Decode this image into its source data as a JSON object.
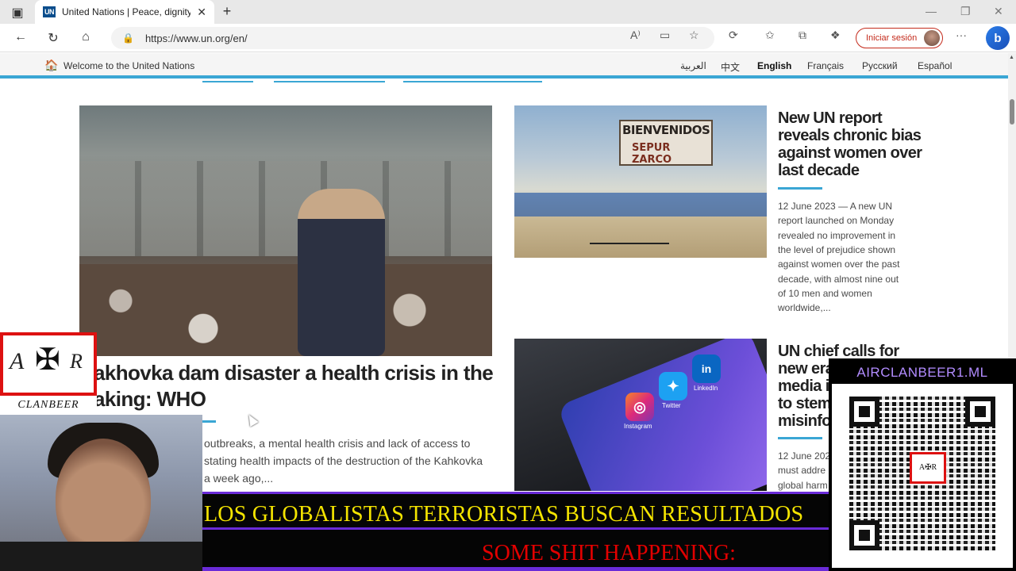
{
  "browser": {
    "tab_title": "United Nations | Peace, dignity a",
    "tab_favicon_text": "UN",
    "url": "https://www.un.org/en/",
    "signin_label": "Iniciar sesión",
    "bing_label": "b"
  },
  "unbar": {
    "welcome": "Welcome to the United Nations",
    "languages": [
      {
        "label": "العربية",
        "active": false
      },
      {
        "label": "中文",
        "active": false
      },
      {
        "label": "English",
        "active": true
      },
      {
        "label": "Français",
        "active": false
      },
      {
        "label": "Русский",
        "active": false
      },
      {
        "label": "Español",
        "active": false
      }
    ]
  },
  "main_story": {
    "headline_line1": "akhovka dam disaster a health crisis in the",
    "headline_line2": "aking: WHO",
    "summary_line1": "outbreaks, a mental health crisis and lack of access to",
    "summary_line2": "stating health impacts of the destruction of the Kahkovka",
    "summary_line3": "a week ago,..."
  },
  "story_2": {
    "image_sign_line1": "BIENVENIDOS",
    "image_sign_line2": "SEPUR ZARCO",
    "headline_lines": [
      "New UN report",
      "reveals chronic bias",
      "against women over",
      "last decade"
    ],
    "summary_lines": [
      "12 June 2023 — A new UN",
      "report launched on Monday",
      "revealed no improvement in",
      "the level of prejudice shown",
      "against women over the past",
      "decade, with almost nine out",
      "of 10 men and women",
      "worldwide,..."
    ]
  },
  "story_3": {
    "headline_lines": [
      "UN chief calls for",
      "new era",
      "media in",
      "to stem",
      "misinfor"
    ],
    "summary_lines": [
      "12 June 202",
      "must addre",
      "global harm"
    ],
    "app_labels": [
      "Instagram",
      "Twitter",
      "LinkedIn"
    ]
  },
  "overlay": {
    "logo_letters": [
      "A",
      "R"
    ],
    "logo_cross": "✠",
    "clan_label": "CLANBEER",
    "ticker_line1": "LOS GLOBALISTAS TERRORISTAS BUSCAN RESULTADOS",
    "ticker_line2": "SOME SHIT HAPPENING:",
    "qr_header": "AIRCLANBEER1.ML",
    "qr_logo_text": "A✠R"
  },
  "colors": {
    "un_blue": "#3aa6d4",
    "signin_red": "#c42b1c",
    "ticker_yellow": "#f4e400",
    "ticker_red": "#e30000",
    "ticker_purple": "#6a2bd8"
  },
  "icons": [
    "sidebar-toggle-icon",
    "close-icon",
    "plus-icon",
    "back-icon",
    "reload-icon",
    "home-icon",
    "lock-icon",
    "read-aloud-icon",
    "immersive-reader-icon",
    "star-icon",
    "extensions-icon",
    "favorites-icon",
    "collections-icon",
    "performance-icon",
    "more-icon"
  ]
}
